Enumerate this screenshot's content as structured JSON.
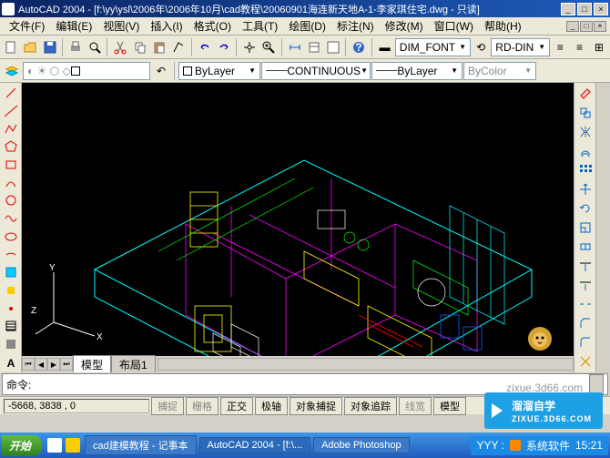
{
  "window": {
    "title": "AutoCAD 2004 - [f:\\yy\\ysl\\2006年\\2006年10月\\cad教程\\20060901海连新天地A-1-李家琪住宅.dwg - 只读]",
    "min": "_",
    "max": "□",
    "close": "×"
  },
  "menu": {
    "items": [
      "文件(F)",
      "编辑(E)",
      "视图(V)",
      "插入(I)",
      "格式(O)",
      "工具(T)",
      "绘图(D)",
      "标注(N)",
      "修改(M)",
      "窗口(W)",
      "帮助(H)"
    ]
  },
  "toolbar1": {
    "dim_style": "DIM_FONT",
    "rd_dim": "RD-DIN"
  },
  "toolbar2": {
    "layer": "ByLayer",
    "linetype": "CONTINUOUS",
    "lineweight": "ByLayer",
    "color": "ByColor"
  },
  "tabs": {
    "model": "模型",
    "layout1": "布局1"
  },
  "ucs": {
    "x": "X",
    "y": "Y",
    "z": "Z"
  },
  "command": {
    "prompt": "命令:"
  },
  "status": {
    "coords": "-5668,  3838 , 0",
    "toggles": [
      "捕捉",
      "栅格",
      "正交",
      "极轴",
      "对象捕捉",
      "对象追踪",
      "线宽",
      "模型"
    ]
  },
  "watermark_url": "zixue.3d66.com",
  "brand": {
    "name": "溜溜自学",
    "sub": "ZIXUE.3D66.COM"
  },
  "taskbar": {
    "start": "开始",
    "items": [
      "cad建模教程 - 记事本",
      "AutoCAD 2004 - [f:\\...",
      "Adobe Photoshop"
    ],
    "tray_text": "YYY :",
    "tray_label": "系统软件",
    "time": "15:21"
  }
}
